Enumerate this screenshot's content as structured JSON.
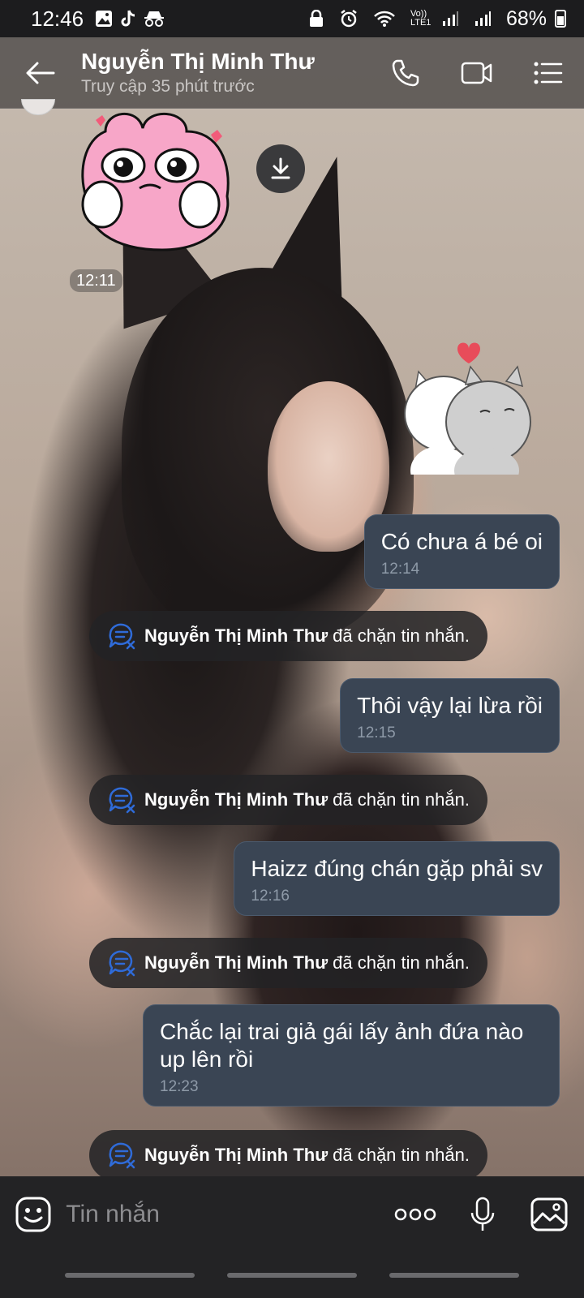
{
  "status_bar": {
    "time": "12:46",
    "network_label": "Vo)) LTE1",
    "battery": "68%"
  },
  "header": {
    "contact_name": "Nguyễn Thị Minh Thư",
    "last_seen": "Truy cập 35 phút trước"
  },
  "chat": {
    "sticker_time": "12:11",
    "messages": [
      {
        "text": "Có chưa á bé oi",
        "time": "12:14"
      },
      {
        "text": "Thôi vậy lại lừa rồi",
        "time": "12:15"
      },
      {
        "text": "Haizz đúng chán gặp phải sv",
        "time": "12:16"
      },
      {
        "text": "Chắc lại trai giả gái lấy ảnh đứa nào up lên rồi",
        "time": "12:23"
      }
    ],
    "block_notice": {
      "name": "Nguyễn Thị Minh Thư",
      "text": "đã chặn tin nhắn."
    }
  },
  "input_bar": {
    "placeholder": "Tin nhắn"
  },
  "colors": {
    "bubble": "#3a4554",
    "header": "#3e3c3c",
    "notice_icon": "#2f6bd8"
  },
  "icons": [
    "back-arrow-icon",
    "phone-icon",
    "video-call-icon",
    "menu-list-icon",
    "download-icon",
    "blocked-chat-icon",
    "emoji-icon",
    "more-icon",
    "microphone-icon",
    "gallery-icon"
  ]
}
